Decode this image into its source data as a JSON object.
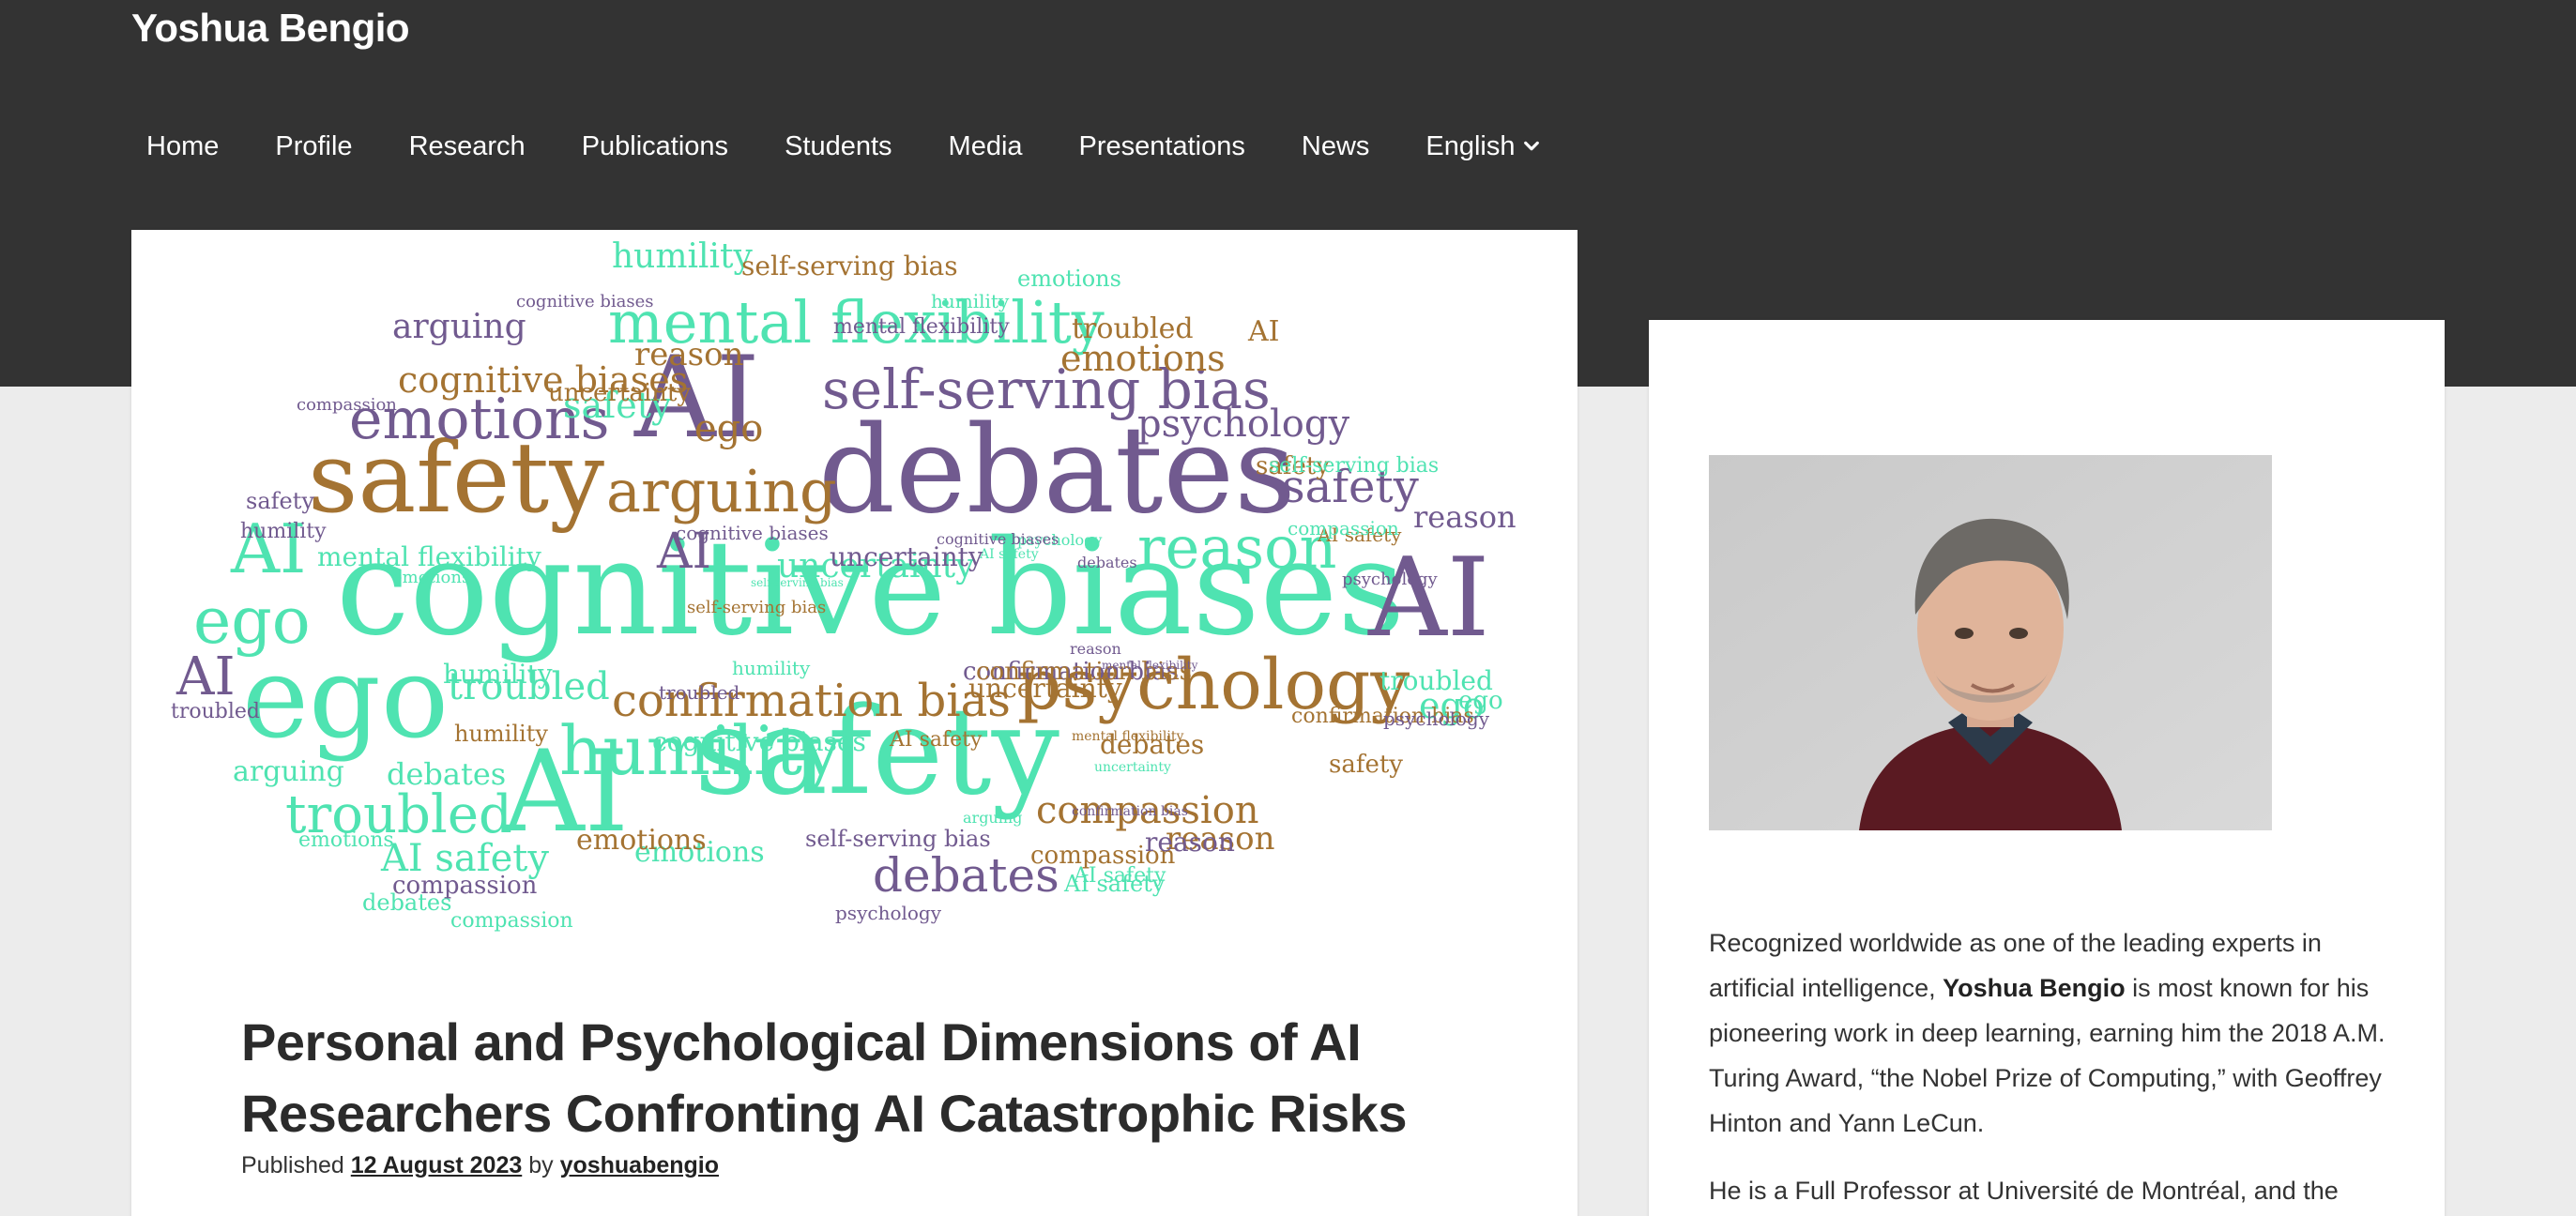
{
  "site": {
    "title": "Yoshua Bengio"
  },
  "nav": {
    "items": [
      "Home",
      "Profile",
      "Research",
      "Publications",
      "Students",
      "Media",
      "Presentations",
      "News"
    ],
    "language": "English"
  },
  "colors": {
    "band": "#333333",
    "teal": "#4fe3b1",
    "purple": "#715a8f",
    "brown": "#a47332"
  },
  "post": {
    "title": "Personal and Psychological Dimensions of AI Researchers Confronting AI Catastrophic Risks",
    "published_label": "Published",
    "date": "12 August 2023",
    "by_label": "by",
    "author": "yoshuabengio"
  },
  "sidebar": {
    "bio_1_pre": "Recognized worldwide as one of the leading experts in artificial intelligence, ",
    "bio_1_name": "Yoshua Bengio",
    "bio_1_post": " is most known for his pioneering work in deep learning, earning him the 2018 A.M. Turing Award, “the Nobel Prize of Computing,” with Geoffrey Hinton and Yann LeCun.",
    "bio_2": "He is a Full Professor at Université de Montréal, and the"
  },
  "wordcloud": {
    "words": [
      {
        "t": "cognitive biases",
        "c": "teal"
      },
      {
        "t": "debates",
        "c": "purple"
      },
      {
        "t": "AI",
        "c": "purple"
      },
      {
        "t": "AI",
        "c": "purple"
      },
      {
        "t": "ego",
        "c": "teal"
      },
      {
        "t": "safety",
        "c": "teal"
      },
      {
        "t": "AI",
        "c": "teal"
      },
      {
        "t": "safety",
        "c": "brown"
      },
      {
        "t": "mental flexibility",
        "c": "teal"
      },
      {
        "t": "psychology",
        "c": "brown"
      },
      {
        "t": "humility",
        "c": "teal"
      },
      {
        "t": "self-serving bias",
        "c": "purple"
      },
      {
        "t": "emotions",
        "c": "purple"
      },
      {
        "t": "ego",
        "c": "teal"
      },
      {
        "t": "troubled",
        "c": "teal"
      },
      {
        "t": "arguing",
        "c": "brown"
      },
      {
        "t": "confirmation bias",
        "c": "brown"
      },
      {
        "t": "reason",
        "c": "teal"
      },
      {
        "t": "uncertainty",
        "c": "teal"
      },
      {
        "t": "compassion",
        "c": "brown"
      },
      {
        "t": "debates",
        "c": "purple"
      },
      {
        "t": "safety",
        "c": "purple"
      },
      {
        "t": "AI safety",
        "c": "teal"
      },
      {
        "t": "cognitive biases",
        "c": "brown"
      },
      {
        "t": "emotions",
        "c": "brown"
      },
      {
        "t": "troubled",
        "c": "teal"
      },
      {
        "t": "psychology",
        "c": "purple"
      },
      {
        "t": "reason",
        "c": "purple"
      },
      {
        "t": "ego",
        "c": "brown"
      },
      {
        "t": "ego",
        "c": "teal"
      },
      {
        "t": "safety",
        "c": "teal"
      },
      {
        "t": "arguing",
        "c": "purple"
      },
      {
        "t": "reason",
        "c": "brown"
      },
      {
        "t": "humility",
        "c": "teal"
      },
      {
        "t": "self-serving bias",
        "c": "brown"
      },
      {
        "t": "emotions",
        "c": "teal"
      },
      {
        "t": "troubled",
        "c": "brown"
      },
      {
        "t": "AI",
        "c": "teal"
      },
      {
        "t": "AI",
        "c": "purple"
      },
      {
        "t": "AI",
        "c": "brown"
      },
      {
        "t": "AI",
        "c": "purple"
      },
      {
        "t": "mental flexibility",
        "c": "teal"
      },
      {
        "t": "uncertainty",
        "c": "purple"
      },
      {
        "t": "uncertainty",
        "c": "brown"
      },
      {
        "t": "arguing",
        "c": "teal"
      },
      {
        "t": "debates",
        "c": "teal"
      },
      {
        "t": "reason",
        "c": "brown"
      },
      {
        "t": "troubled",
        "c": "teal"
      },
      {
        "t": "humility",
        "c": "brown"
      },
      {
        "t": "confirmation bias",
        "c": "purple"
      },
      {
        "t": "confirmation bias",
        "c": "brown"
      },
      {
        "t": "humility",
        "c": "teal"
      },
      {
        "t": "cognitive biases",
        "c": "teal"
      },
      {
        "t": "AI safety",
        "c": "brown"
      },
      {
        "t": "debates",
        "c": "brown"
      },
      {
        "t": "safety",
        "c": "brown"
      },
      {
        "t": "ego",
        "c": "teal"
      },
      {
        "t": "AI safety",
        "c": "teal"
      },
      {
        "t": "emotions",
        "c": "brown"
      },
      {
        "t": "self-serving bias",
        "c": "purple"
      },
      {
        "t": "compassion",
        "c": "brown"
      },
      {
        "t": "reason",
        "c": "purple"
      },
      {
        "t": "compassion",
        "c": "purple"
      },
      {
        "t": "debates",
        "c": "teal"
      },
      {
        "t": "compassion",
        "c": "teal"
      },
      {
        "t": "psychology",
        "c": "purple"
      },
      {
        "t": "AI safety",
        "c": "teal"
      },
      {
        "t": "emotions",
        "c": "teal"
      },
      {
        "t": "troubled",
        "c": "purple"
      },
      {
        "t": "humility",
        "c": "purple"
      },
      {
        "t": "safety",
        "c": "purple"
      },
      {
        "t": "psychology",
        "c": "purple"
      },
      {
        "t": "mental flexibility",
        "c": "purple"
      },
      {
        "t": "compassion",
        "c": "purple"
      },
      {
        "t": "cognitive biases",
        "c": "purple"
      },
      {
        "t": "uncertainty",
        "c": "brown"
      },
      {
        "t": "humility",
        "c": "teal"
      },
      {
        "t": "emotions",
        "c": "teal"
      },
      {
        "t": "safety",
        "c": "brown"
      },
      {
        "t": "self-serving bias",
        "c": "teal"
      },
      {
        "t": "AI safety",
        "c": "brown"
      },
      {
        "t": "compassion",
        "c": "teal"
      },
      {
        "t": "psychology",
        "c": "teal"
      },
      {
        "t": "uncertainty",
        "c": "teal"
      },
      {
        "t": "mental flexibility",
        "c": "brown"
      },
      {
        "t": "confirmation bias",
        "c": "brown"
      },
      {
        "t": "self-serving bias",
        "c": "brown"
      },
      {
        "t": "arguing",
        "c": "teal"
      },
      {
        "t": "debates",
        "c": "purple"
      },
      {
        "t": "reason",
        "c": "purple"
      },
      {
        "t": "psychology",
        "c": "purple"
      },
      {
        "t": "troubled",
        "c": "purple"
      },
      {
        "t": "cognitive biases",
        "c": "purple"
      },
      {
        "t": "cognitive biases",
        "c": "purple"
      },
      {
        "t": "emotions",
        "c": "teal"
      },
      {
        "t": "self-serving bias",
        "c": "teal"
      },
      {
        "t": "mental flexibility",
        "c": "purple"
      },
      {
        "t": "humility",
        "c": "teal"
      },
      {
        "t": "confirmation bias",
        "c": "purple"
      },
      {
        "t": "AI safety",
        "c": "teal"
      },
      {
        "t": "uncertainty",
        "c": "purple"
      }
    ]
  }
}
